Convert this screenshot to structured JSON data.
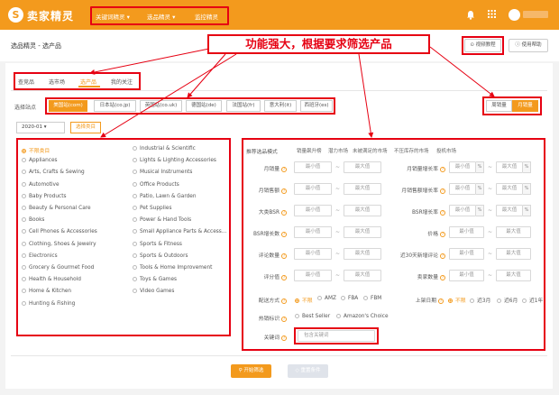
{
  "header": {
    "logo_mark": "S",
    "logo_text": "卖家精灵",
    "nav": [
      "关键词精灵 ▾",
      "选品精灵 ▾",
      "监控精灵"
    ],
    "icons": [
      "bell-icon",
      "apps-grid-icon",
      "user-avatar-icon"
    ]
  },
  "titlebar": {
    "title": "选品精灵 - 选产品",
    "video_button": "视频教程",
    "help_button": "使用帮助"
  },
  "annotation": {
    "banner": "功能强大，根据要求筛选产品"
  },
  "tabs": {
    "items": [
      "查竞品",
      "选市场",
      "选产品",
      "我的关注"
    ],
    "active": "选产品"
  },
  "site": {
    "label": "选择站点",
    "options": [
      "美国站(com)",
      "日本站(co.jp)",
      "英国站(co.uk)",
      "德国站(de)",
      "法国站(fr)",
      "意大利(it)",
      "西班牙(es)"
    ],
    "active": "美国站(com)",
    "mode_options": [
      "周销量",
      "月销量"
    ],
    "mode_active": "月销量"
  },
  "date": {
    "value": "2020-01 ▾",
    "category_button": "选择类目"
  },
  "categories": {
    "left": [
      "不限类目",
      "Appliances",
      "Arts, Crafts & Sewing",
      "Automotive",
      "Baby Products",
      "Beauty & Personal Care",
      "Books",
      "Cell Phones & Accessories",
      "Clothing, Shoes & Jewelry",
      "Electronics",
      "Grocery & Gourmet Food",
      "Health & Household",
      "Home & Kitchen",
      "Hunting & Fishing"
    ],
    "right": [
      "Industrial & Scientific",
      "Lights & Lighting Accessories",
      "Musical Instruments",
      "Office Products",
      "Patio, Lawn & Garden",
      "Pet Supplies",
      "Power & Hand Tools",
      "Small Appliance Parts & Access...",
      "Sports & Fitness",
      "Sports & Outdoors",
      "Tools & Home Improvement",
      "Toys & Games",
      "Video Games"
    ],
    "selected": "不限类目"
  },
  "filters": {
    "mode_label": "推荐选品模式",
    "modes": [
      "销量飙升榜",
      "潜力市场",
      "未被满足的市场",
      "不压库存的市场",
      "投机市场"
    ],
    "min_placeholder": "最小值",
    "max_placeholder": "最大值",
    "percent": "%",
    "left_rows": [
      "月销量",
      "月销售额",
      "大类BSR",
      "BSR增长数",
      "评论数量",
      "评分值"
    ],
    "right_rows": [
      "月销量增长率",
      "月销售额增长率",
      "BSR增长率",
      "价格",
      "近30天新增评论",
      "卖家数量"
    ],
    "shipping_label": "配送方式",
    "shipping_options": [
      "不限",
      "AMZ",
      "FBA",
      "FBM"
    ],
    "shipping_selected": "不限",
    "listing_label": "上架日期",
    "listing_options": [
      "不限",
      "近3月",
      "近6月",
      "近1年"
    ],
    "listing_selected": "不限",
    "hot_label": "热销标识",
    "hot_options": [
      "Best Seller",
      "Amazon's Choice"
    ],
    "keyword_label": "关键词",
    "keyword_placeholder": "包含关键词"
  },
  "actions": {
    "start": "开始筛选",
    "reset": "重置条件"
  },
  "colors": {
    "brand": "#f39a1d",
    "annotation": "#e60012"
  }
}
